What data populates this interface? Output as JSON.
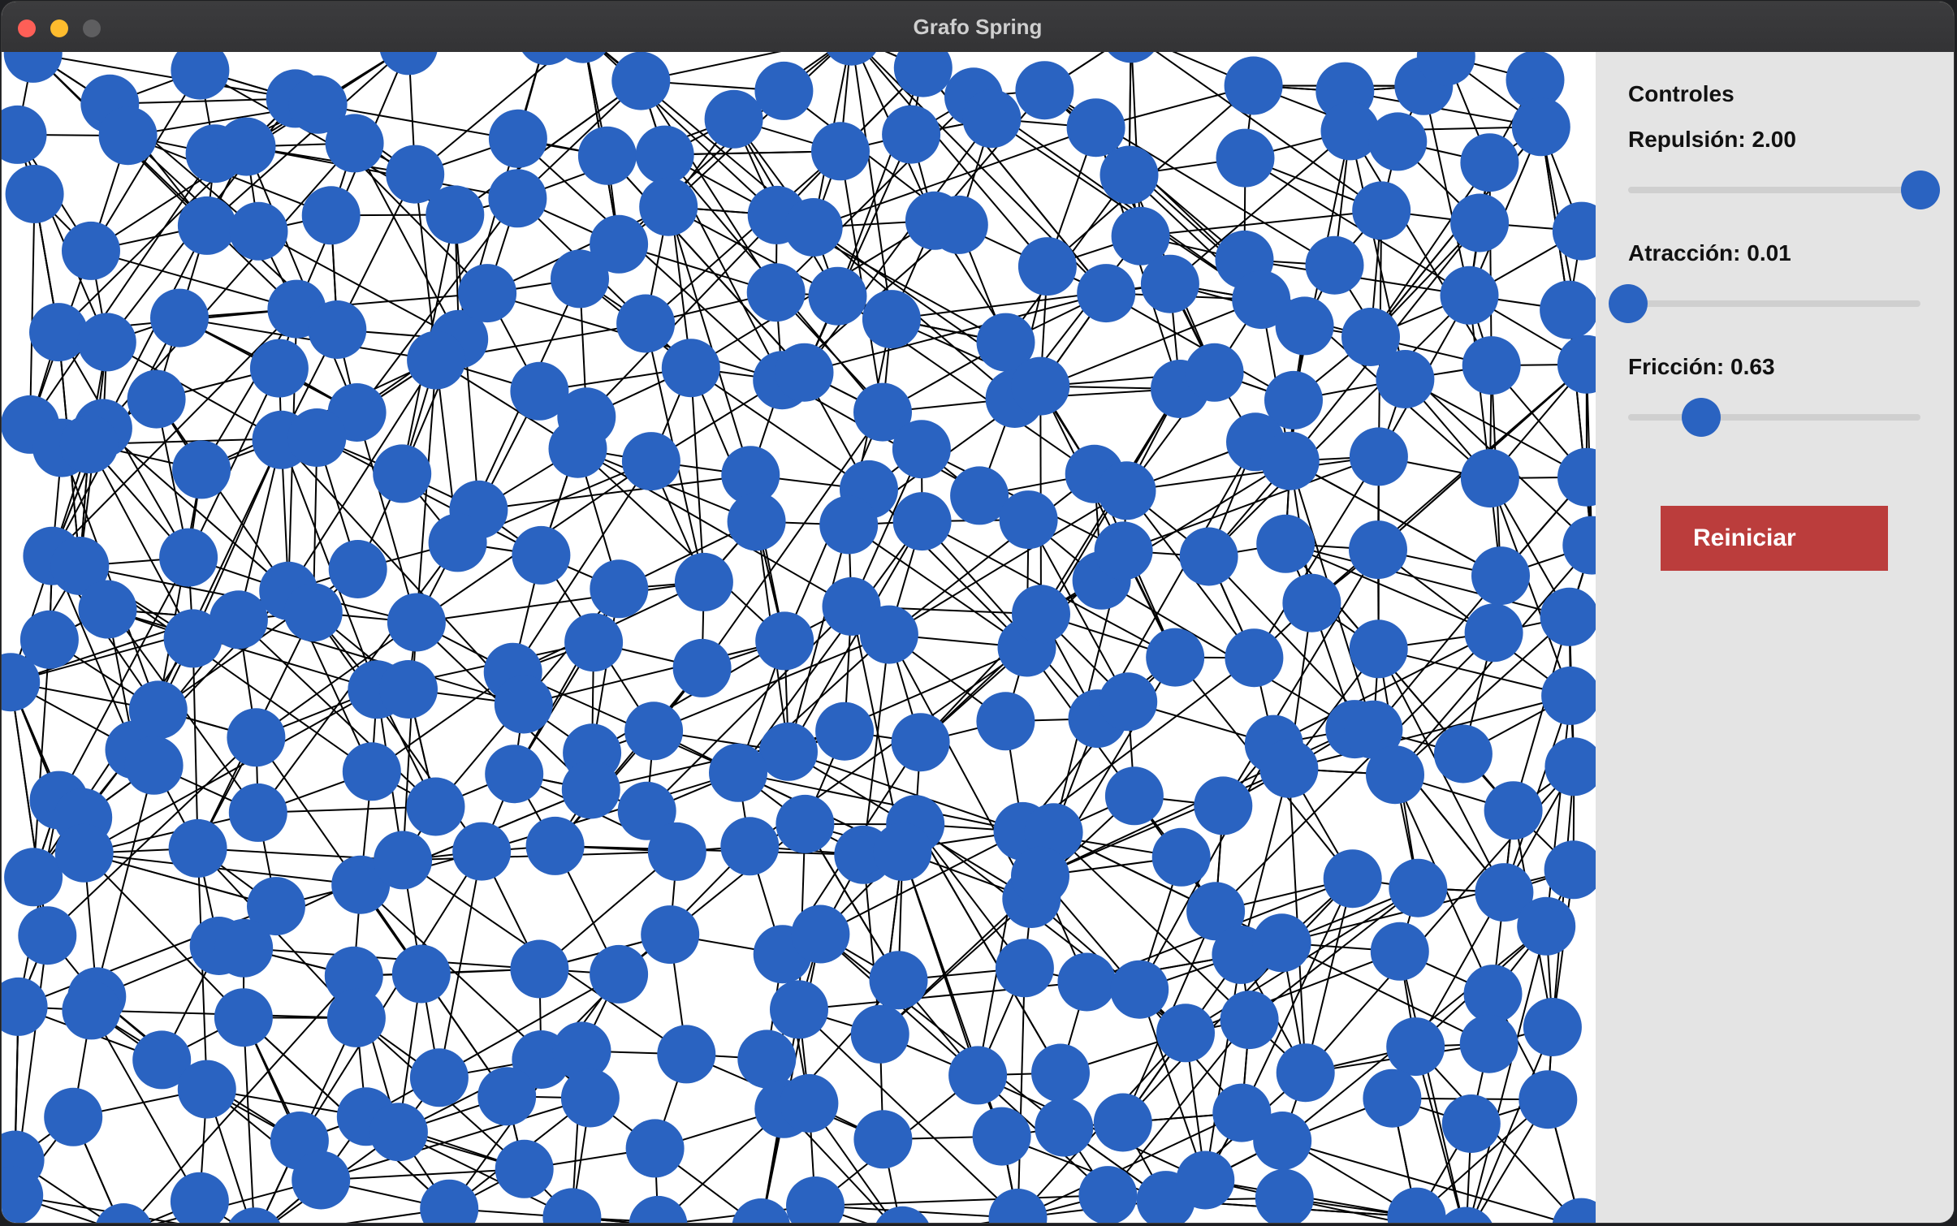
{
  "window": {
    "title": "Grafo Spring"
  },
  "panel": {
    "heading": "Controles",
    "sliders": [
      {
        "label": "Repulsión: 2.00",
        "fraction": 1.0
      },
      {
        "label": "Atracción: 0.01",
        "fraction": 0.0
      },
      {
        "label": "Fricción: 0.63",
        "fraction": 0.25
      }
    ],
    "reset_label": "Reiniciar"
  },
  "graph": {
    "node_color": "#2a63c1",
    "edge_color": "#000000",
    "grid_cols": 20,
    "grid_rows": 15,
    "extra_edges": 700,
    "seed": 7
  }
}
